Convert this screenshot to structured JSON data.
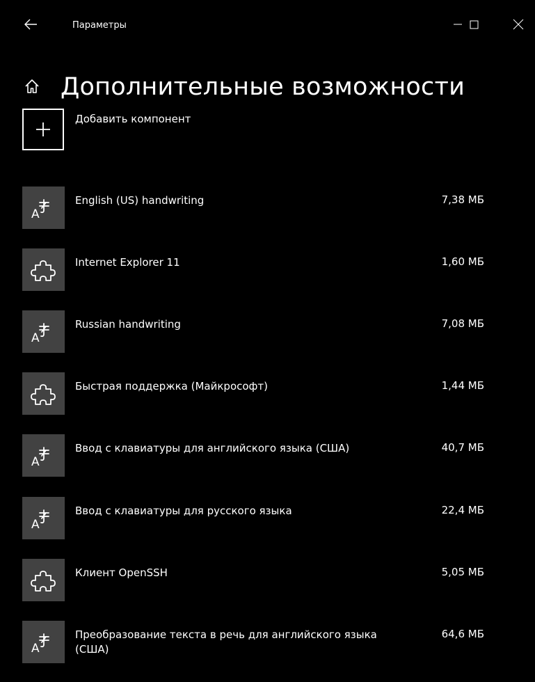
{
  "window": {
    "title": "Параметры"
  },
  "page": {
    "title": "Дополнительные возможности"
  },
  "add_component": {
    "label": "Добавить компонент"
  },
  "features": [
    {
      "name": "English (US) handwriting",
      "size": "7,38 МБ",
      "icon": "language-handwriting-icon"
    },
    {
      "name": "Internet Explorer 11",
      "size": "1,60 МБ",
      "icon": "puzzle-piece-icon"
    },
    {
      "name": "Russian handwriting",
      "size": "7,08 МБ",
      "icon": "language-handwriting-icon"
    },
    {
      "name": "Быстрая поддержка (Майкрософт)",
      "size": "1,44 МБ",
      "icon": "puzzle-piece-icon"
    },
    {
      "name": "Ввод с клавиатуры для английского языка (США)",
      "size": "40,7 МБ",
      "icon": "language-handwriting-icon"
    },
    {
      "name": "Ввод с клавиатуры для русского языка",
      "size": "22,4 МБ",
      "icon": "language-handwriting-icon"
    },
    {
      "name": "Клиент OpenSSH",
      "size": "5,05 МБ",
      "icon": "puzzle-piece-icon"
    },
    {
      "name": "Преобразование текста в речь для английского языка (США)",
      "size": "64,6 МБ",
      "icon": "language-handwriting-icon"
    }
  ],
  "colors": {
    "background": "#000000",
    "foreground": "#ffffff",
    "icon_tile": "#424242"
  }
}
